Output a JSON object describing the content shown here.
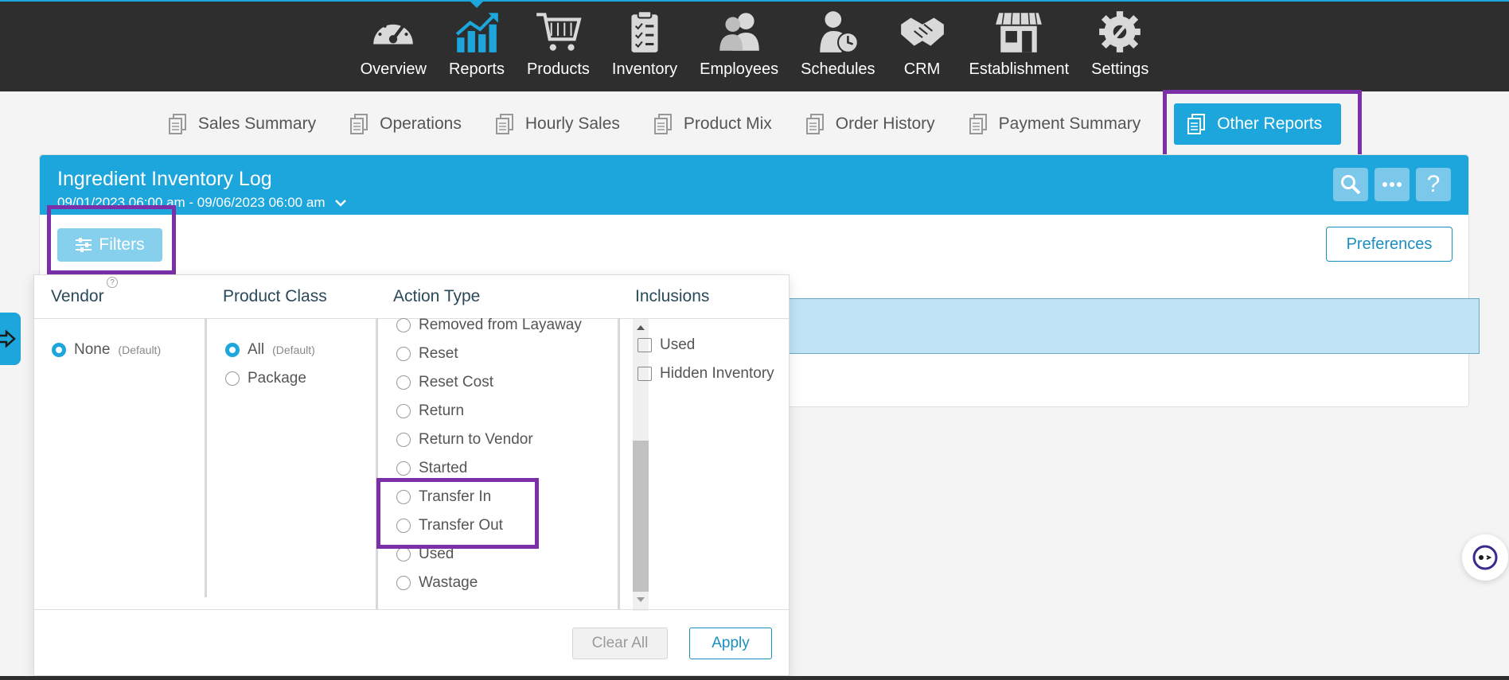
{
  "nav": {
    "items": [
      {
        "label": "Overview",
        "icon": "speedometer-icon"
      },
      {
        "label": "Reports",
        "icon": "chart-up-icon"
      },
      {
        "label": "Products",
        "icon": "cart-icon"
      },
      {
        "label": "Inventory",
        "icon": "clipboard-icon"
      },
      {
        "label": "Employees",
        "icon": "people-icon"
      },
      {
        "label": "Schedules",
        "icon": "person-clock-icon"
      },
      {
        "label": "CRM",
        "icon": "handshake-icon"
      },
      {
        "label": "Establishment",
        "icon": "storefront-icon"
      },
      {
        "label": "Settings",
        "icon": "gear-icon"
      }
    ],
    "active": "Reports"
  },
  "tabs": [
    "Sales Summary",
    "Operations",
    "Hourly Sales",
    "Product Mix",
    "Order History",
    "Payment Summary",
    "Other Reports"
  ],
  "report": {
    "title": "Ingredient Inventory Log",
    "date_range": "09/01/2023 06:00 am - 09/06/2023 06:00 am",
    "filters_label": "Filters",
    "preferences_label": "Preferences",
    "help_glyph": "?"
  },
  "filter_panel": {
    "vendor": {
      "heading": "Vendor",
      "options": [
        {
          "label": "None",
          "note": "(Default)",
          "selected": true
        }
      ]
    },
    "product_class": {
      "heading": "Product Class",
      "options": [
        {
          "label": "All",
          "note": "(Default)",
          "selected": true
        },
        {
          "label": "Package",
          "note": "",
          "selected": false
        }
      ]
    },
    "action_type": {
      "heading": "Action Type",
      "options": [
        "Removed from Layaway",
        "Reset",
        "Reset Cost",
        "Return",
        "Return to Vendor",
        "Started",
        "Transfer In",
        "Transfer Out",
        "Used",
        "Wastage"
      ]
    },
    "inclusions": {
      "heading": "Inclusions",
      "options": [
        "Used",
        "Hidden Inventory"
      ]
    },
    "clear_label": "Clear All",
    "apply_label": "Apply"
  },
  "colors": {
    "accent": "#1da6dc",
    "highlight": "#7b2fa8",
    "topbar": "#2e2e2e"
  }
}
